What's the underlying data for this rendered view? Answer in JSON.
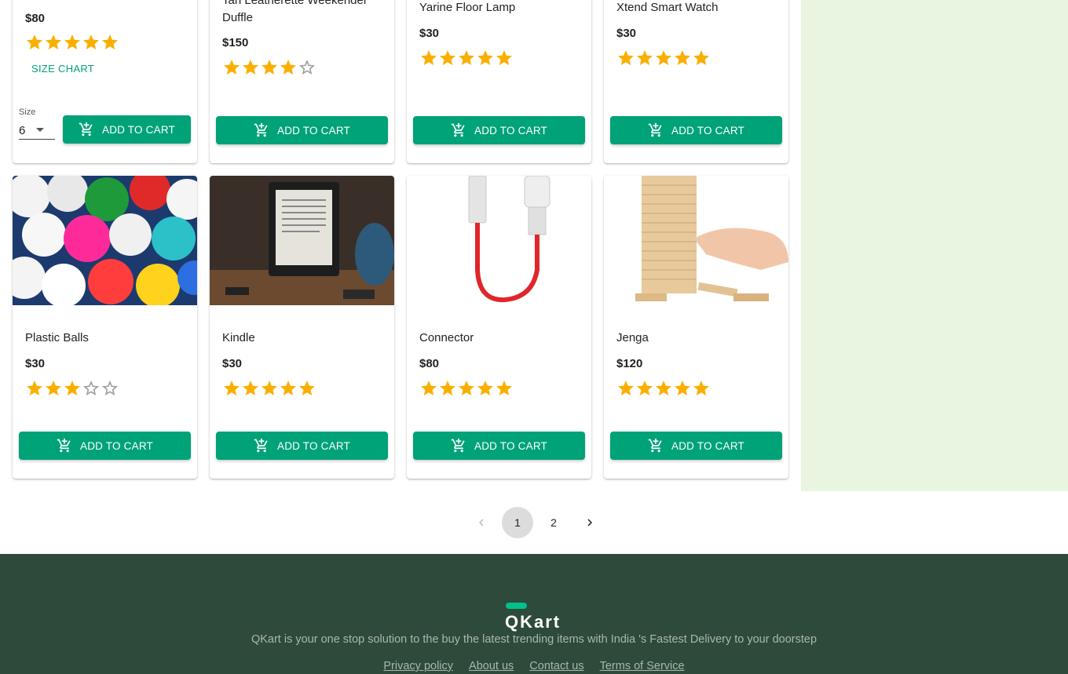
{
  "top_row": [
    {
      "name": "",
      "price": "$80",
      "rating": 5,
      "size_chart": "SIZE CHART",
      "size_label": "Size",
      "size_value": "6",
      "button": "ADD TO CART"
    },
    {
      "name": "Tan Leatherette Weekender Duffle",
      "price": "$150",
      "rating": 4,
      "button": "ADD TO CART"
    },
    {
      "name": "Yarine Floor Lamp",
      "price": "$30",
      "rating": 5,
      "button": "ADD TO CART"
    },
    {
      "name": "Xtend Smart Watch",
      "price": "$30",
      "rating": 5,
      "button": "ADD TO CART"
    }
  ],
  "bottom_row": [
    {
      "name": "Plastic Balls",
      "price": "$30",
      "rating": 3,
      "button": "ADD TO CART",
      "image": "plastic-balls-image"
    },
    {
      "name": "Kindle",
      "price": "$30",
      "rating": 5,
      "button": "ADD TO CART",
      "image": "kindle-image"
    },
    {
      "name": "Connector",
      "price": "$80",
      "rating": 5,
      "button": "ADD TO CART",
      "image": "connector-image"
    },
    {
      "name": "Jenga",
      "price": "$120",
      "rating": 5,
      "button": "ADD TO CART",
      "image": "jenga-image"
    }
  ],
  "pagination": {
    "pages": [
      "1",
      "2"
    ],
    "current": "1",
    "prev_icon": "chevron-left-icon",
    "next_icon": "chevron-right-icon"
  },
  "footer": {
    "logo": "QKart",
    "tagline": "QKart is your one stop solution to the buy the latest trending items with India 's Fastest Delivery to your doorstep",
    "links": [
      "Privacy policy",
      "About us",
      "Contact us",
      "Terms of Service"
    ]
  },
  "colors": {
    "accent": "#00a278",
    "star": "#faaf00",
    "cart_panel": "#e9f5e1",
    "footer": "#2d4a3a"
  }
}
